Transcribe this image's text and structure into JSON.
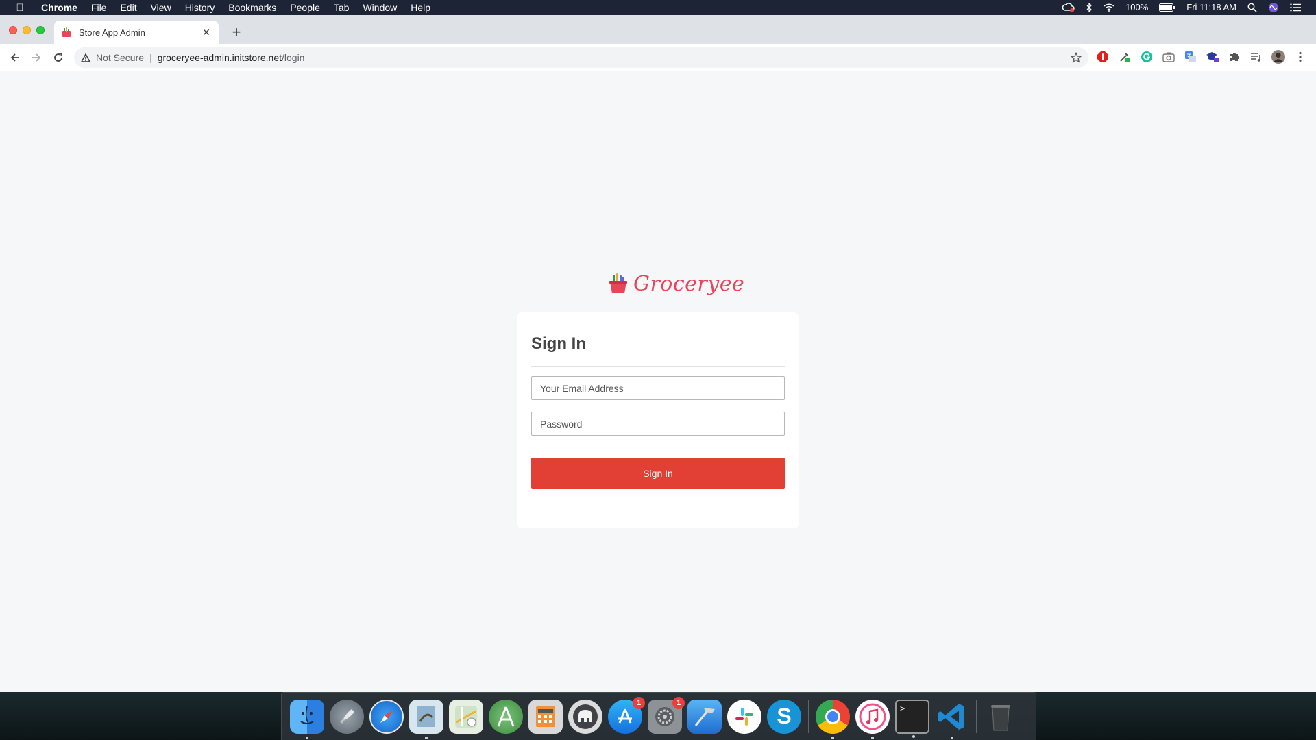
{
  "menubar": {
    "app_name": "Chrome",
    "items": [
      "File",
      "Edit",
      "View",
      "History",
      "Bookmarks",
      "People",
      "Tab",
      "Window",
      "Help"
    ],
    "battery": "100%",
    "clock": "Fri 11:18 AM"
  },
  "browser": {
    "tab_title": "Store App Admin",
    "url_security": "Not Secure",
    "url_host": "groceryee-admin.initstore.net",
    "url_path": "/login"
  },
  "page": {
    "brand": "Groceryee",
    "heading": "Sign In",
    "email_placeholder": "Your Email Address",
    "password_placeholder": "Password",
    "submit_label": "Sign In"
  },
  "dock": {
    "apps": [
      {
        "name": "finder",
        "badge": ""
      },
      {
        "name": "launchpad",
        "badge": ""
      },
      {
        "name": "safari",
        "badge": ""
      },
      {
        "name": "preview",
        "badge": ""
      },
      {
        "name": "maps",
        "badge": ""
      },
      {
        "name": "android-studio",
        "badge": ""
      },
      {
        "name": "calculator",
        "badge": ""
      },
      {
        "name": "sequel-pro",
        "badge": ""
      },
      {
        "name": "app-store",
        "badge": "1"
      },
      {
        "name": "system-preferences",
        "badge": "1"
      },
      {
        "name": "xcode",
        "badge": ""
      },
      {
        "name": "slack",
        "badge": ""
      },
      {
        "name": "skype",
        "badge": ""
      },
      {
        "name": "chrome",
        "badge": ""
      },
      {
        "name": "itunes",
        "badge": ""
      },
      {
        "name": "terminal",
        "badge": ""
      },
      {
        "name": "vscode",
        "badge": ""
      },
      {
        "name": "trash",
        "badge": ""
      }
    ]
  },
  "colors": {
    "brand": "#e8445a",
    "button": "#e24034",
    "page_bg": "#f6f7f9"
  }
}
